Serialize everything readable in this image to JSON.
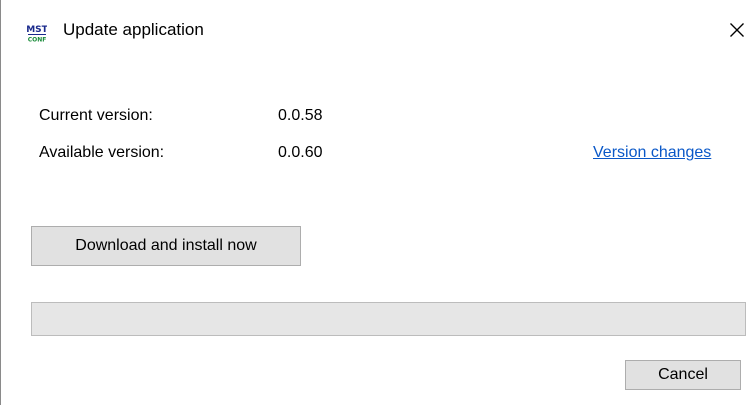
{
  "window": {
    "title": "Update application",
    "close_glyph": "✕",
    "app_icon": "mst-conf-app-icon"
  },
  "versions": {
    "current_label": "Current version:",
    "current_value": "0.0.58",
    "available_label": "Available version:",
    "available_value": "0.0.60",
    "changes_link": "Version changes"
  },
  "actions": {
    "download_label": "Download and install now",
    "cancel_label": "Cancel"
  },
  "progress": {
    "value": 0
  },
  "colors": {
    "link": "#0a58c8",
    "button_bg": "#e1e1e1",
    "progress_track": "#e6e6e6"
  }
}
